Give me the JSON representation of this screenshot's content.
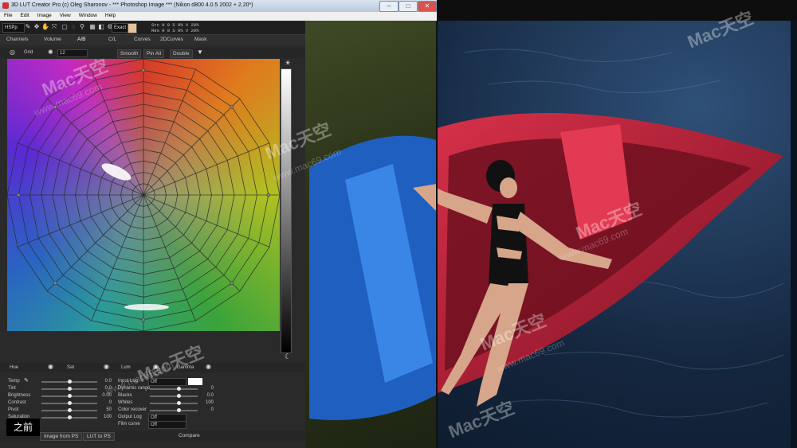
{
  "window": {
    "title": "3D LUT Creator Pro (c) Oleg Sharonov - *** Photoshop Image *** (Nikon d800 4.0.5 2002 + 2.20*)",
    "minimize": "–",
    "maximize": "□",
    "close": "✕"
  },
  "menu": [
    "File",
    "Edit",
    "Image",
    "View",
    "Window",
    "Help"
  ],
  "toolbar": {
    "mode": "HSPp",
    "exact_label": "Exact",
    "readout_line1": "Src  H  0  S  0%  V  20%",
    "readout_line2": "Res  H  0  S  0%  V  20%",
    "icons": [
      "eyedropper-icon",
      "move-icon",
      "pan-icon",
      "scale-icon",
      "select-icon",
      "lasso-icon",
      "zoom-icon",
      "grid-icon",
      "compare-icon",
      "settings-icon"
    ]
  },
  "tabs": [
    "Channels",
    "Volume",
    "A/B",
    "C/L",
    "Curves",
    "2DCurves",
    "Mask"
  ],
  "active_tab": "A/B",
  "grid_bar": {
    "grid_label": "Grid",
    "grid_value": "12",
    "smooth": "Smooth",
    "pin_all": "Pin All",
    "double": "Double"
  },
  "hsl_row": {
    "hue": "Hue",
    "sat": "Sat",
    "lum": "Lum",
    "gamma": "Gamma"
  },
  "left_sliders": [
    {
      "label": "Temp",
      "value": "0.0",
      "pos": 0.5
    },
    {
      "label": "Tint",
      "value": "0.0",
      "pos": 0.5
    },
    {
      "label": "Brightness",
      "value": "0.00",
      "pos": 0.5
    },
    {
      "label": "Contrast",
      "value": "0",
      "pos": 0.5
    },
    {
      "label": "Pivot",
      "value": "50",
      "pos": 0.5
    },
    {
      "label": "Saturation",
      "value": "100",
      "pos": 0.5
    }
  ],
  "right_controls": [
    {
      "label": "Input Log",
      "type": "dropdown",
      "value": "Off"
    },
    {
      "label": "Dynamic range",
      "type": "slider",
      "value": "0",
      "pos": 0.6
    },
    {
      "label": "Blacks",
      "type": "slider",
      "value": "0.0",
      "pos": 0.6
    },
    {
      "label": "Whites",
      "type": "slider",
      "value": "100",
      "pos": 0.6
    },
    {
      "label": "Color recover",
      "type": "slider",
      "value": "0",
      "pos": 0.6
    },
    {
      "label": "Output Log",
      "type": "dropdown",
      "value": "Off"
    },
    {
      "label": "Film curve",
      "type": "dropdown",
      "value": "Off"
    }
  ],
  "bottom_buttons": {
    "image_from_ps": "Image from PS",
    "lut_to_ps": "LUT to PS",
    "compare": "Compare"
  },
  "overlay_caption": "之前",
  "watermark": {
    "brand": "Mac天空",
    "url": "www.mac69.com"
  },
  "colors": {
    "swatch": "#e5c49a"
  }
}
